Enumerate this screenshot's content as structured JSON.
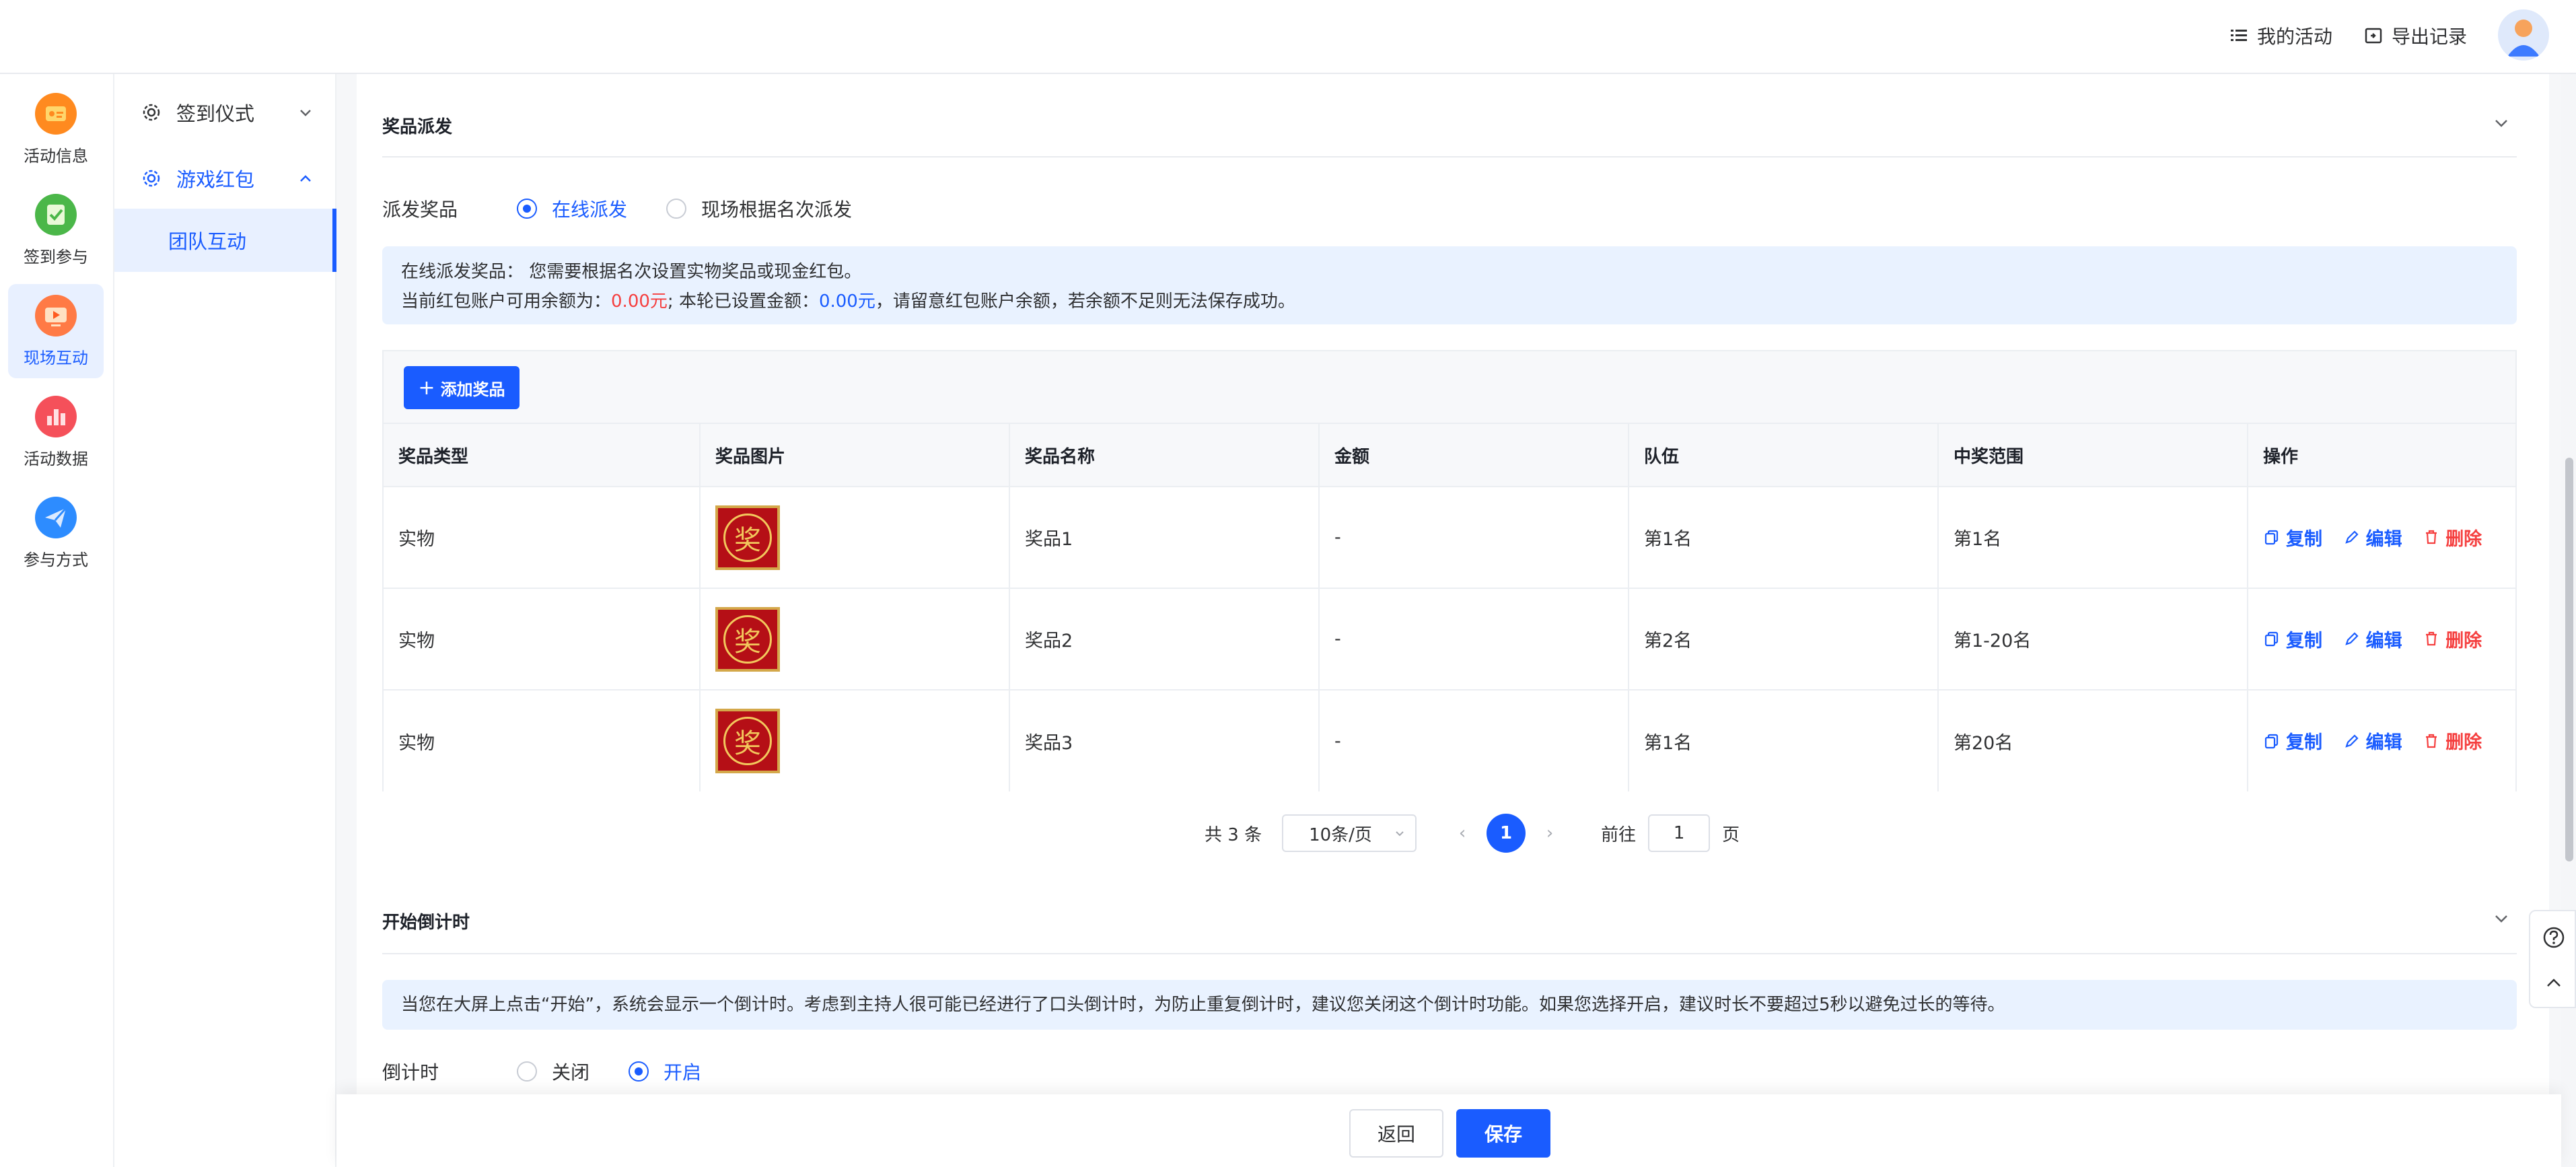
{
  "topbar": {
    "my_activities": "我的活动",
    "export_records": "导出记录"
  },
  "rail": [
    {
      "label": "活动信息",
      "icon": "activity-info-icon",
      "color": "#ff8a1f"
    },
    {
      "label": "签到参与",
      "icon": "checkin-icon",
      "color": "#4bb749"
    },
    {
      "label": "现场互动",
      "icon": "live-interaction-icon",
      "color": "#ff7a45"
    },
    {
      "label": "活动数据",
      "icon": "data-chart-icon",
      "color": "#f5505a"
    },
    {
      "label": "参与方式",
      "icon": "paper-plane-icon",
      "color": "#2d8cff"
    }
  ],
  "subnav": {
    "item1": "签到仪式",
    "item2": "游戏红包",
    "child": "团队互动"
  },
  "prize_section": {
    "title": "奖品派发",
    "mode_label": "派发奖品",
    "option_online": "在线派发",
    "option_onsite": "现场根据名次派发",
    "notice_line1": "在线派发奖品： 您需要根据名次设置实物奖品或现金红包。",
    "notice_a": "当前红包账户可用余额为：",
    "balance": "0.00元",
    "notice_b": "; 本轮已设置金额：",
    "set_amount": "0.00元",
    "notice_c": "，请留意红包账户余额，若余额不足则无法保存成功。",
    "add_button": "添加奖品",
    "headers": [
      "奖品类型",
      "奖品图片",
      "奖品名称",
      "金额",
      "队伍",
      "中奖范围",
      "操作"
    ],
    "rows": [
      {
        "type": "实物",
        "name": "奖品1",
        "amount": "-",
        "team": "第1名",
        "range": "第1名"
      },
      {
        "type": "实物",
        "name": "奖品2",
        "amount": "-",
        "team": "第2名",
        "range": "第1-20名"
      },
      {
        "type": "实物",
        "name": "奖品3",
        "amount": "-",
        "team": "第1名",
        "range": "第20名"
      }
    ],
    "prize_glyph": "奖",
    "ops": {
      "copy": "复制",
      "edit": "编辑",
      "delete": "删除"
    }
  },
  "pager": {
    "total": "共 3 条",
    "page_size": "10条/页",
    "current": "1",
    "goto": "前往",
    "goto_value": "1",
    "page_suffix": "页"
  },
  "countdown_section": {
    "title": "开始倒计时",
    "notice": "当您在大屏上点击“开始”，系统会显示一个倒计时。考虑到主持人很可能已经进行了口头倒计时，为防止重复倒计时，建议您关闭这个倒计时功能。如果您选择开启，建议时长不要超过5秒以避免过长的等待。",
    "label": "倒计时",
    "option_off": "关闭",
    "option_on": "开启"
  },
  "bottom": {
    "back": "返回",
    "save": "保存"
  }
}
